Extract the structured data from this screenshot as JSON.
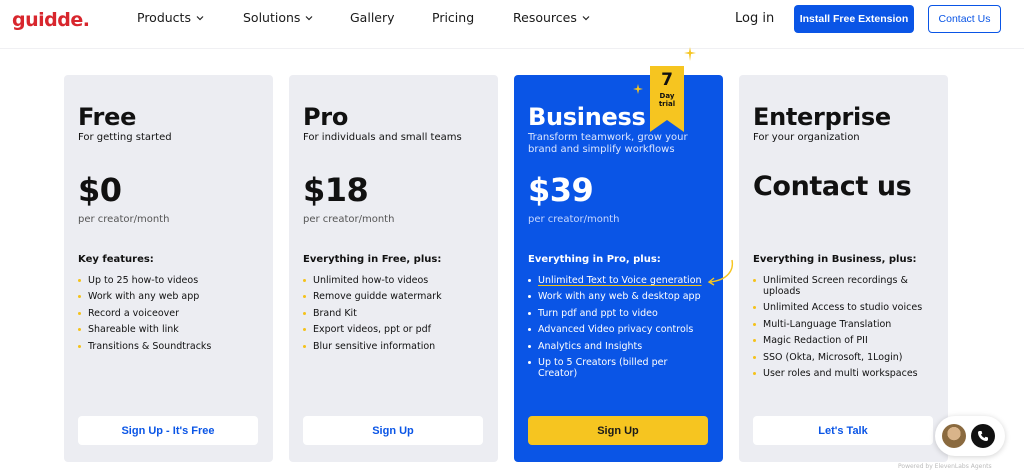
{
  "nav": {
    "logo": "guidde.",
    "items": [
      {
        "label": "Products",
        "has_dropdown": true
      },
      {
        "label": "Solutions",
        "has_dropdown": true
      },
      {
        "label": "Gallery",
        "has_dropdown": false
      },
      {
        "label": "Pricing",
        "has_dropdown": false
      },
      {
        "label": "Resources",
        "has_dropdown": true
      }
    ],
    "login": "Log in",
    "install_button": "Install Free Extension",
    "contact_button": "Contact Us"
  },
  "plans": [
    {
      "name": "Free",
      "subtitle": "For getting started",
      "price": "$0",
      "price_unit": "per creator/month",
      "features_heading": "Key features:",
      "features": [
        "Up to 25 how-to videos",
        "Work with any web app",
        "Record a voiceover",
        "Shareable with link",
        "Transitions & Soundtracks"
      ],
      "cta": "Sign Up - It's Free"
    },
    {
      "name": "Pro",
      "subtitle": "For individuals and small teams",
      "price": "$18",
      "price_unit": "per creator/month",
      "features_heading": "Everything in Free, plus:",
      "features": [
        "Unlimited how-to videos",
        "Remove guidde watermark",
        "Brand Kit",
        "Export videos, ppt or pdf",
        "Blur sensitive information"
      ],
      "cta": "Sign Up"
    },
    {
      "name": "Business",
      "subtitle": "Transform teamwork, grow your brand and simplify workflows",
      "price": "$39",
      "price_unit": "per creator/month",
      "features_heading": "Everything in Pro, plus:",
      "features": [
        "Unlimited Text to Voice generation",
        "Work with any web & desktop app",
        "Turn pdf and ppt to video",
        "Advanced Video privacy controls",
        "Analytics and Insights",
        "Up to 5 Creators (billed per Creator)"
      ],
      "cta": "Sign Up",
      "ribbon": {
        "number": "7",
        "line1": "Day",
        "line2": "trial"
      }
    },
    {
      "name": "Enterprise",
      "subtitle": "For your organization",
      "price": "Contact us",
      "features_heading": "Everything in Business, plus:",
      "features": [
        "Unlimited Screen recordings & uploads",
        "Unlimited Access to studio voices",
        "Multi-Language Translation",
        "Magic Redaction of PII",
        "SSO (Okta, Microsoft, 1Login)",
        "User roles and multi workspaces"
      ],
      "cta": "Let's Talk"
    }
  ],
  "widget": {
    "powered_by": "Powered by ElevenLabs Agents"
  },
  "colors": {
    "brand_blue": "#0a55e6",
    "brand_red": "#d8262d",
    "accent_yellow": "#f6c520",
    "card_gray": "#ecedf2"
  }
}
